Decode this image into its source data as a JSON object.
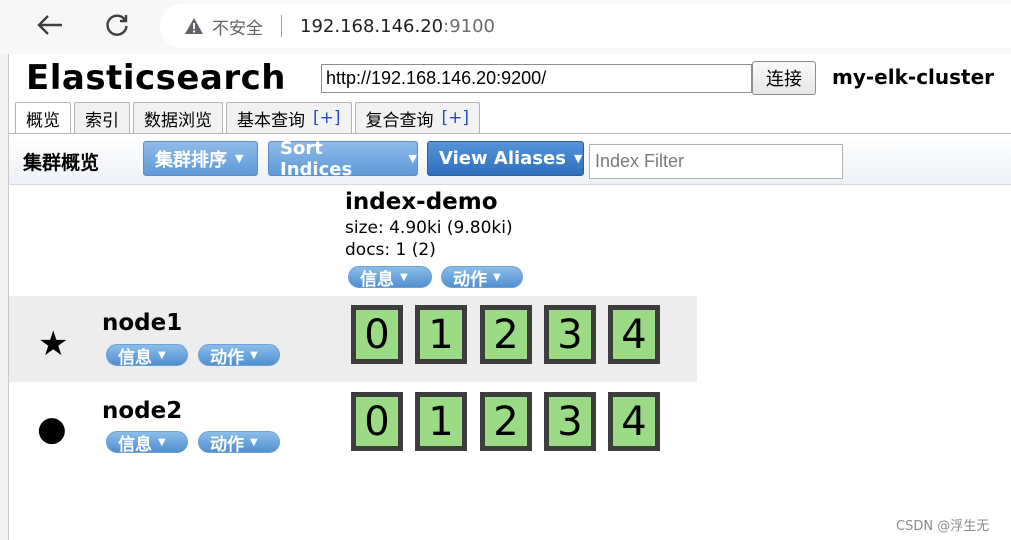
{
  "browser": {
    "security_label": "不安全",
    "url_host": "192.168.146.20",
    "url_port": ":9100"
  },
  "app": {
    "title": "Elasticsearch",
    "connection_url": "http://192.168.146.20:9200/",
    "connect_label": "连接",
    "cluster_name": "my-elk-cluster"
  },
  "tabs": [
    {
      "label": "概览",
      "plus": ""
    },
    {
      "label": "索引",
      "plus": ""
    },
    {
      "label": "数据浏览",
      "plus": ""
    },
    {
      "label": "基本查询",
      "plus": "[+]"
    },
    {
      "label": "复合查询",
      "plus": "[+]"
    }
  ],
  "toolbar": {
    "section_label": "集群概览",
    "sort_cluster_label": "集群排序",
    "sort_indices_label": "Sort Indices",
    "view_aliases_label": "View Aliases",
    "index_filter_placeholder": "Index Filter"
  },
  "index": {
    "name": "index-demo",
    "size": "size: 4.90ki (9.80ki)",
    "docs": "docs: 1 (2)",
    "info_label": "信息",
    "action_label": "动作"
  },
  "nodes": [
    {
      "name": "node1",
      "icon": "★",
      "info_label": "信息",
      "action_label": "动作",
      "shards": [
        "0",
        "1",
        "2",
        "3",
        "4"
      ]
    },
    {
      "name": "node2",
      "icon": "●",
      "info_label": "信息",
      "action_label": "动作",
      "shards": [
        "0",
        "1",
        "2",
        "3",
        "4"
      ]
    }
  ],
  "colors": {
    "shard_fill": "#9bdb85",
    "shard_border": "#3d3d3d",
    "button_blue": "#5f9ada"
  },
  "watermark": "CSDN @浮生无"
}
